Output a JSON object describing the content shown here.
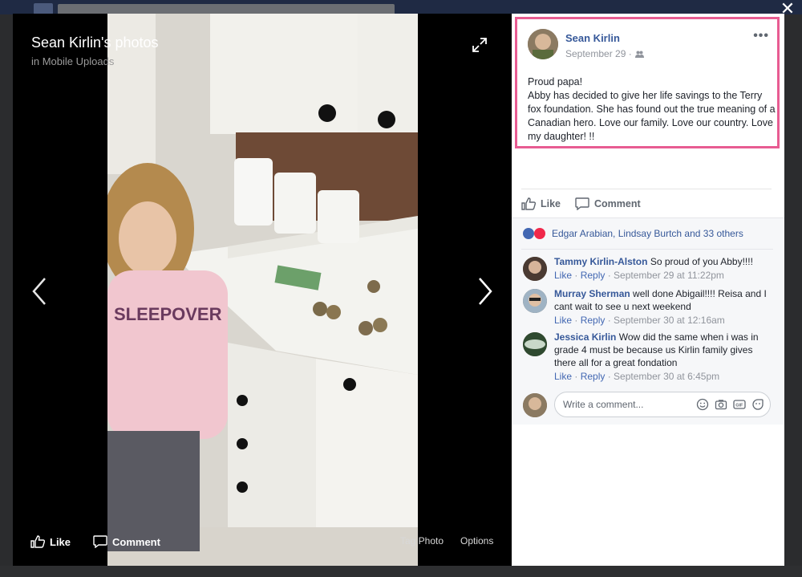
{
  "viewer": {
    "title": "Sean Kirlin's photos",
    "subtitle": "in Mobile Uploads",
    "like_label": "Like",
    "comment_label": "Comment",
    "tag_photo_label": "Tag Photo",
    "options_label": "Options"
  },
  "post": {
    "author": "Sean Kirlin",
    "date": "September 29 ·",
    "text": "Proud papa!\nAbby has decided to give her life savings to the Terry fox foundation. She has found out the true meaning of a Canadian hero. Love our family. Love our country. Love my daughter! !!",
    "like_label": "Like",
    "comment_label": "Comment"
  },
  "reactions": {
    "names": "Edgar Arabian, Lindsay Burtch and 33 others"
  },
  "comments": [
    {
      "name": "Tammy Kirlin-Alston",
      "text": "So proud of you Abby!!!!",
      "like": "Like",
      "reply": "Reply",
      "time": "September 29 at 11:22pm"
    },
    {
      "name": "Murray Sherman",
      "text": "well done Abigail!!!! Reisa and I cant wait to see u next weekend",
      "like": "Like",
      "reply": "Reply",
      "time": "September 30 at 12:16am"
    },
    {
      "name": "Jessica Kirlin",
      "text": "Wow did the same when i was in grade 4 must be because us Kirlin family gives there all for a great fondation",
      "like": "Like",
      "reply": "Reply",
      "time": "September 30 at 6:45pm"
    }
  ],
  "composer": {
    "placeholder": "Write a comment..."
  },
  "colors": {
    "highlight_border": "#e85c92",
    "link": "#365899",
    "like_blue": "#4267b2",
    "love_red": "#f0284a"
  }
}
